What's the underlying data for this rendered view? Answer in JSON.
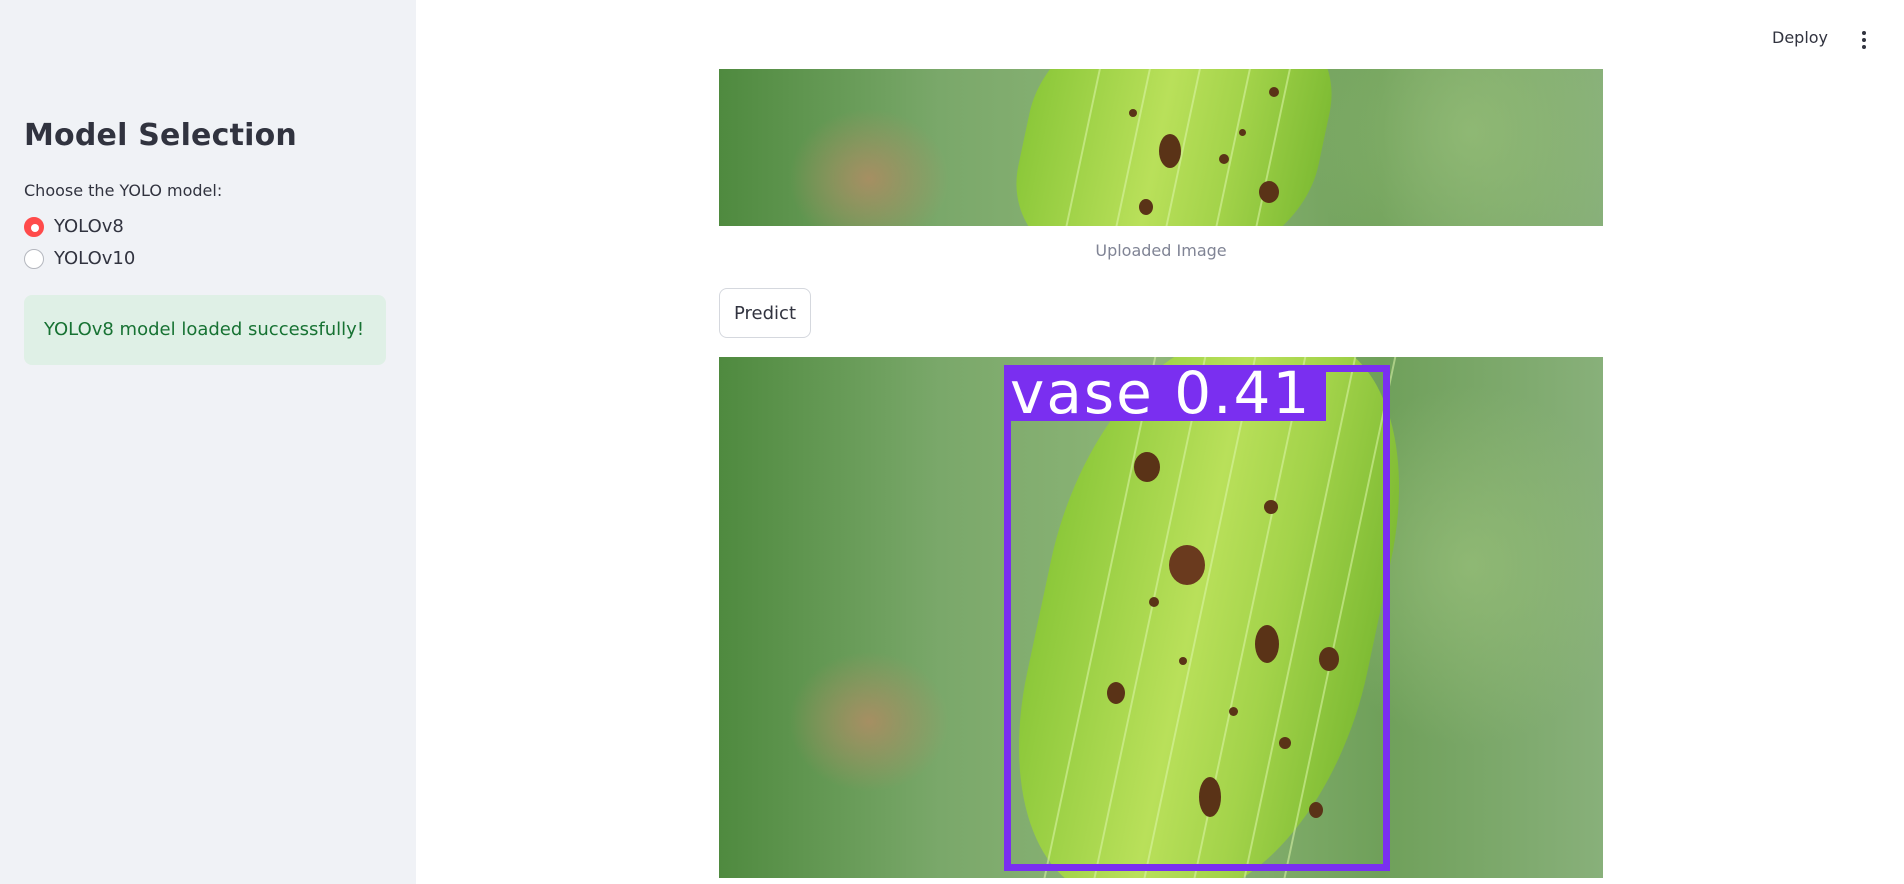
{
  "header": {
    "deploy_label": "Deploy",
    "menu_icon": "vertical-ellipsis-icon"
  },
  "sidebar": {
    "title": "Model Selection",
    "radio_label": "Choose the YOLO model:",
    "options": [
      {
        "label": "YOLOv8",
        "selected": true
      },
      {
        "label": "YOLOv10",
        "selected": false
      }
    ],
    "status_message": "YOLOv8 model loaded successfully!"
  },
  "main": {
    "uploaded_caption": "Uploaded Image",
    "predict_label": "Predict",
    "detection": {
      "label": "vase 0.41",
      "box_color": "#7a2ff0"
    }
  },
  "colors": {
    "accent": "#ff4b4b",
    "sidebar_bg": "#f0f2f6",
    "success_bg": "#dff0e6",
    "success_text": "#177233"
  }
}
